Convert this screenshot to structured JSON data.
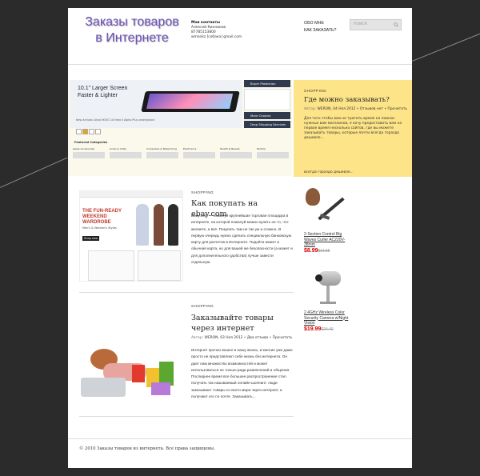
{
  "header": {
    "logo_line1": "Заказы товаров",
    "logo_line2": "в Интернете",
    "contacts_title": "Мои контакты",
    "contacts_name": "Алексей Кинников",
    "contacts_phone": "87785153800",
    "contacts_email": "wmonkz [собака] gmail.com",
    "nav": [
      "ОБО МНЕ",
      "КАК ЗАКАЗАТЬ?"
    ],
    "search_placeholder": "ПОИСК"
  },
  "banner": {
    "promo_line1": "10.1\" Larger Screen",
    "promo_line2": "Faster & Lighter",
    "caption": "New Arrivals: Ainol NOVO 10 Hero II Alpha Plus smartphone",
    "side_items": [
      "Buyer Protection",
      "More Choices",
      "Drop Shipping Services"
    ],
    "featured_title": "Featured Categories",
    "categories": [
      "Apple Accessories",
      "Audio & Video",
      "Computers & Networking",
      "Electronics",
      "Health & Beauty",
      "Fashion"
    ]
  },
  "featured": {
    "category": "SHOPPING",
    "title": "Где можно заказывать?",
    "meta_author_label": "Автор:",
    "meta_author": "WERON",
    "meta_date": "04 Ноя 2012",
    "meta_comments": "Отзывов нет",
    "read_more": "Прочитать",
    "excerpt": "Для того чтобы вам не тратить время на поиски нужных вам магазинов, я хочу предоставить вам на первое время несколько сайтов, где вы можете заказывать товары, которые почти всегда гораздо дешевле...",
    "bar_text": "всегда гораздо дешевле..."
  },
  "posts": [
    {
      "category": "SHOPPING",
      "title": "Как покупать на ebay.com",
      "excerpt": "Ebay.com — пожалуй крупнейшая торговая площадка в интернете, на которой пожалуй можно купить не то, что желаете, а всё. Покупать там не так уж и сложно. В первую очередь нужно сделать специальную банковскую карту для расчетов в Интернете. Подойти может и обычная карта, но для вашей же безопасности (а может и для дополнительного удобства) лучше завести отдельную.",
      "img_banner": "THE FUN-READY WEEKEND WARDROBE",
      "img_sub": "Men's & Women's Styles",
      "img_btn": "Shop now"
    },
    {
      "category": "SHOPPING",
      "title": "Заказывайте товары через интернет",
      "meta_author_label": "Автор:",
      "meta_author": "WERON",
      "meta_date": "03 Ноя 2012",
      "meta_comments": "Два отзыва",
      "read_more": "Прочитать",
      "excerpt": "Интернет прочно вошел в нашу жизнь, и многие уже даже просто не представляют себе жизнь без интернета. Он дает нам множество возможностей и может использоваться не только ради развлечений и общения. Последнее время все большее распространение стал получать так называемый онлайн-шоппинг: люди заказывают товары со всего мира через интернет, а получают его по почте. Заказывать..."
    }
  ],
  "products": [
    {
      "title": "2-Section Control Big Waves Curler AC220V-38mm",
      "price": "$8.99",
      "old_price": "$11.55"
    },
    {
      "title": "2.4GHz Wireless Color Security Camera w/Night Vision",
      "price": "$19.99",
      "old_price": "$24.40"
    }
  ],
  "footer": {
    "copyright": "© 2010 Заказы товаров из интернета. Все права защищены."
  },
  "colors": {
    "yellow": "#fde488",
    "background": "#2b2b2b",
    "logo": "#6a4fb8",
    "price": "#d40000"
  }
}
